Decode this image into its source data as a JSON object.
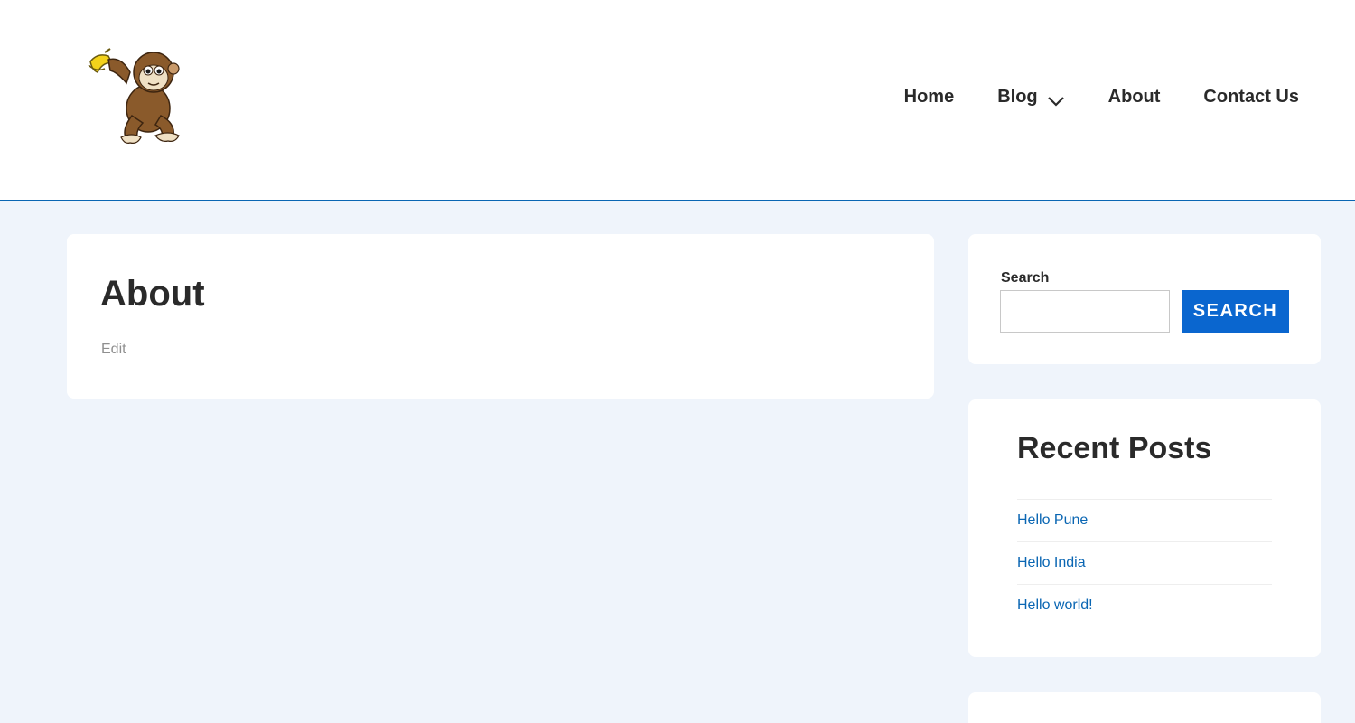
{
  "header": {
    "logo_icon": "monkey-banana-logo",
    "nav": [
      {
        "label": "Home"
      },
      {
        "label": "Blog",
        "icon": "chevron-down-icon"
      },
      {
        "label": "About"
      },
      {
        "label": "Contact Us"
      }
    ]
  },
  "main": {
    "title": "About",
    "edit_label": "Edit"
  },
  "sidebar": {
    "search": {
      "label": "Search",
      "placeholder": "",
      "value": "",
      "button_label": "SEARCH"
    },
    "recent_posts": {
      "title": "Recent Posts",
      "items": [
        {
          "label": "Hello Pune"
        },
        {
          "label": "Hello India"
        },
        {
          "label": "Hello world!"
        }
      ]
    }
  },
  "colors": {
    "accent": "#0a66cf",
    "link": "#0a66b3",
    "background": "#eff4fb",
    "header_border": "#0a66b3"
  }
}
